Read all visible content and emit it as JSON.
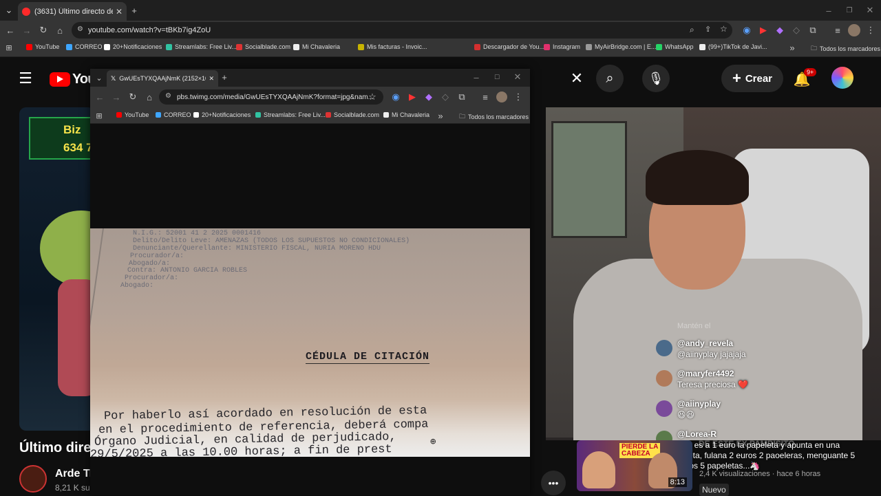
{
  "browser": {
    "tab_title": "(3631) Último directo del año -",
    "url": "youtube.com/watch?v=tBKb7ig4ZoU",
    "bookmarks": [
      {
        "label": "YouTube",
        "color": "#ff0000"
      },
      {
        "label": "CORREO",
        "color": "#3ea6ff"
      },
      {
        "label": "20+Notificaciones",
        "color": "#ffffff"
      },
      {
        "label": "Streamlabs: Free Liv...",
        "color": "#31c3a2"
      },
      {
        "label": "Socialblade.com",
        "color": "#d33"
      },
      {
        "label": "Mi Chavaleria",
        "color": "#eeeeee"
      },
      {
        "label": "Mis facturas - Invoic...",
        "color": "#c7b300"
      },
      {
        "label": "Descargador de You...",
        "color": "#d32f2f"
      },
      {
        "label": "Instagram",
        "color": "#e1306c"
      },
      {
        "label": "MyAirBridge.com | E...",
        "color": "#999999"
      },
      {
        "label": "WhatsApp",
        "color": "#25d366"
      },
      {
        "label": "(99+)TikTok de Javi...",
        "color": "#eeeeee"
      }
    ],
    "all_bookmarks": "Todos los marcadores"
  },
  "youtube": {
    "logo": "You",
    "create_label": "Crear",
    "notif_count": "9+",
    "video_title": "Último direc",
    "channel_name": "Arde Tr",
    "subs": "8,21 K su",
    "thumb_sign": "Biz\n634 74"
  },
  "chat": {
    "header": "Mantén el",
    "messages": [
      {
        "name": "@andy_revela",
        "text": "@aiinyplay jajajaja",
        "avatar": "#4a6a8a"
      },
      {
        "name": "@maryfer4492",
        "text": "Teresa preciosa ❤️",
        "avatar": "#b07a5a"
      },
      {
        "name": "@aiinyplay",
        "text": "😆😆",
        "avatar": "#7a4a9a"
      },
      {
        "name": "@Lorea-R",
        "text": "Javi es a 1 euro la papeleta y apunta en una\nlibreta, fulana 2 euros 2 paoeleras, menguante 5\neuros 5 papeletas...🦄",
        "avatar": "#5a7a4a"
      }
    ],
    "overlay_partial": "DE ESTE EX PAMBISITO"
  },
  "recommended": {
    "thumb_tag": "PIERDE LA\nCABEZA",
    "duration": "8:13",
    "meta": "2,4 K visualizaciones · hace 6 horas",
    "new_badge": "Nuevo"
  },
  "popup": {
    "tab_title": "GwUEsTYXQAAjNmK (2152×10",
    "url": "pbs.twimg.com/media/GwUEsTYXQAAjNmK?format=jpg&nam...",
    "bookmarks": [
      {
        "label": "YouTube",
        "color": "#ff0000"
      },
      {
        "label": "CORREO",
        "color": "#3ea6ff"
      },
      {
        "label": "20+Notificaciones",
        "color": "#ffffff"
      },
      {
        "label": "Streamlabs: Free Liv...",
        "color": "#31c3a2"
      },
      {
        "label": "Socialblade.com",
        "color": "#d33"
      },
      {
        "label": "Mi Chavaleria",
        "color": "#eeeeee"
      }
    ],
    "all_bookmarks": "Todos los marcadores"
  },
  "document": {
    "header_lines": [
      "N.I.G.: 52001 41 2 2025 0001416",
      "Delito/Delito Leve: AMENAZAS (TODOS LOS SUPUESTOS NO CONDICIONALES)",
      "Denunciante/Querellante: MINISTERIO FISCAL, NURIA MORENO HDU",
      "Procurador/a:",
      "Abogado/a:",
      "Contra: ANTONIO GARCIA ROBLES",
      "Procurador/a:",
      "Abogado:"
    ],
    "title": "CÉDULA DE CITACIÓN",
    "body_lines": [
      "Por haberlo así acordado en resolución de esta",
      "en el procedimiento de referencia, deberá compa",
      "Órgano Judicial, en calidad de perjudicado,",
      "29/5/2025 a las 10.00 horas; a fin de prest"
    ]
  }
}
